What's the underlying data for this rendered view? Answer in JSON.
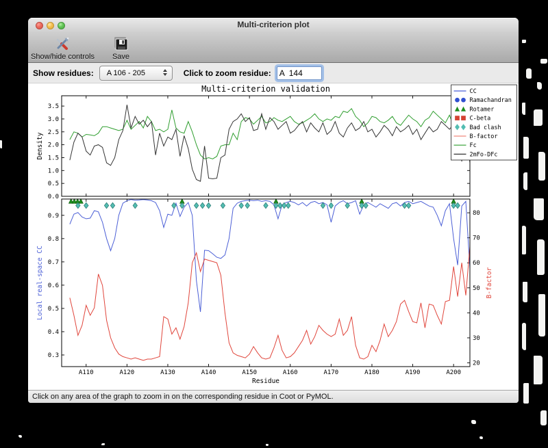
{
  "window": {
    "title": "Multi-criterion plot"
  },
  "toolbar": {
    "buttons": [
      {
        "id": "show-hide-controls",
        "label": "Show/hide controls",
        "icon": "tools-icon"
      },
      {
        "id": "save",
        "label": "Save",
        "icon": "floppy-disk-icon"
      }
    ]
  },
  "controls": {
    "show_residues_label": "Show residues:",
    "residue_range_value": "A 106 - 205",
    "zoom_residue_label": "Click to zoom residue:",
    "zoom_residue_value": "A  144"
  },
  "status_bar": {
    "text": "Click on any area of the graph to zoom in on the corresponding residue in Coot or PyMOL."
  },
  "chart_data": {
    "type": "line",
    "title": "Multi-criterion validation",
    "xlabel": "Residue",
    "x_start": 106,
    "x_range": [
      104,
      204
    ],
    "x_tick_values": [
      110,
      120,
      130,
      140,
      150,
      160,
      170,
      180,
      190,
      200
    ],
    "x_tick_labels": [
      "A110",
      "A120",
      "A130",
      "A140",
      "A150",
      "A160",
      "A170",
      "A180",
      "A190",
      "A200"
    ],
    "grid": false,
    "legend_position": "top-right",
    "legend": [
      {
        "label": "CC",
        "type": "line",
        "color": "#4b5fd6"
      },
      {
        "label": "Ramachandran",
        "type": "circle",
        "color": "#3050d0"
      },
      {
        "label": "Rotamer",
        "type": "triangle",
        "color": "#1e8f1e"
      },
      {
        "label": "C-beta",
        "type": "square",
        "color": "#d44232"
      },
      {
        "label": "Bad clash",
        "type": "diamond",
        "color": "#53bdb2"
      },
      {
        "label": "B-factor",
        "type": "line",
        "color": "#f0867c"
      },
      {
        "label": "Fc",
        "type": "line",
        "color": "#2f9e2f"
      },
      {
        "label": "2mFo-DFc",
        "type": "line",
        "color": "#333333"
      }
    ],
    "panels": [
      {
        "name": "density",
        "ylabel": "Density",
        "ylabel_color": "#000000",
        "ylim": [
          0,
          3.9
        ],
        "yticks": [
          0.0,
          0.5,
          1.0,
          1.5,
          2.0,
          2.5,
          3.0,
          3.5
        ],
        "series": [
          {
            "name": "Fc",
            "color": "#2f9e2f",
            "values": [
              2.2,
              2.5,
              2.45,
              2.3,
              2.4,
              2.38,
              2.35,
              2.45,
              2.7,
              2.7,
              2.65,
              2.6,
              2.55,
              2.6,
              2.95,
              2.6,
              2.75,
              2.9,
              2.65,
              3.1,
              2.9,
              2.55,
              2.6,
              2.5,
              2.6,
              3.35,
              2.65,
              2.5,
              2.45,
              2.9,
              2.5,
              2.0,
              1.6,
              1.45,
              1.5,
              1.45,
              1.55,
              1.95,
              2.0,
              2.0,
              2.45,
              2.2,
              2.9,
              3.05,
              3.0,
              2.8,
              2.95,
              3.1,
              2.85,
              2.9,
              3.05,
              2.95,
              2.9,
              3.0,
              3.1,
              2.9,
              2.8,
              2.85,
              2.95,
              3.05,
              3.2,
              3.0,
              2.9,
              3.0,
              2.95,
              3.1,
              3.05,
              3.3,
              3.25,
              3.4,
              3.1,
              2.95,
              2.7,
              2.85,
              3.1,
              3.05,
              2.9,
              2.85,
              2.95,
              3.1,
              2.85,
              2.75,
              2.95,
              3.15,
              3.0,
              2.9,
              2.7,
              2.95,
              3.05,
              3.3,
              3.15,
              3.0,
              2.85,
              3.15,
              2.7,
              3.25,
              3.0,
              3.2,
              3.15
            ]
          },
          {
            "name": "2mFo-DFc",
            "color": "#333333",
            "values": [
              1.4,
              2.1,
              2.45,
              2.3,
              1.75,
              1.6,
              1.95,
              2.0,
              1.9,
              1.3,
              1.2,
              1.5,
              2.2,
              2.55,
              3.55,
              2.65,
              3.1,
              2.8,
              2.95,
              2.7,
              2.9,
              1.6,
              2.45,
              1.95,
              2.3,
              2.2,
              2.6,
              1.55,
              2.35,
              1.85,
              1.05,
              0.65,
              0.58,
              1.95,
              0.7,
              0.68,
              0.7,
              1.5,
              1.6,
              2.6,
              2.9,
              3.0,
              3.2,
              2.9,
              3.05,
              2.55,
              2.6,
              3.2,
              2.6,
              3.05,
              2.9,
              2.6,
              2.75,
              2.9,
              2.45,
              2.55,
              2.75,
              2.9,
              2.5,
              2.85,
              2.65,
              2.5,
              2.85,
              2.4,
              2.55,
              2.9,
              2.45,
              2.3,
              2.65,
              2.85,
              2.55,
              2.65,
              2.9,
              2.5,
              2.6,
              2.3,
              2.5,
              2.75,
              2.6,
              2.35,
              2.7,
              2.5,
              2.6,
              2.75,
              2.4,
              2.6,
              2.2,
              2.45,
              2.7,
              2.5,
              2.6,
              2.9,
              2.75,
              2.6,
              2.8,
              2.6,
              1.35,
              2.65,
              1.3
            ]
          }
        ]
      },
      {
        "name": "cc-bfactor",
        "left_axis": {
          "label": "Local real-space CC",
          "color": "#4b5fd6",
          "ylim": [
            0.25,
            0.97
          ],
          "yticks": [
            0.3,
            0.4,
            0.5,
            0.6,
            0.7,
            0.8,
            0.9
          ]
        },
        "right_axis": {
          "label": "B-factor",
          "color": "#e0453b",
          "ylim": [
            18.5,
            85.5
          ],
          "yticks": [
            20,
            30,
            40,
            50,
            60,
            70,
            80
          ]
        },
        "series": [
          {
            "name": "CC",
            "axis": "left",
            "color": "#4b5fd6",
            "values": [
              0.862,
              0.905,
              0.912,
              0.893,
              0.885,
              0.888,
              0.92,
              0.915,
              0.87,
              0.8,
              0.748,
              0.8,
              0.9,
              0.952,
              0.963,
              0.968,
              0.965,
              0.966,
              0.968,
              0.966,
              0.963,
              0.955,
              0.92,
              0.848,
              0.905,
              0.9,
              0.952,
              0.895,
              0.935,
              0.955,
              0.9,
              0.62,
              0.485,
              0.75,
              0.748,
              0.735,
              0.72,
              0.715,
              0.73,
              0.8,
              0.93,
              0.952,
              0.96,
              0.963,
              0.965,
              0.963,
              0.965,
              0.96,
              0.963,
              0.96,
              0.945,
              0.885,
              0.945,
              0.955,
              0.96,
              0.955,
              0.945,
              0.955,
              0.94,
              0.955,
              0.96,
              0.95,
              0.955,
              0.945,
              0.87,
              0.94,
              0.955,
              0.963,
              0.95,
              0.955,
              0.963,
              0.905,
              0.945,
              0.955,
              0.945,
              0.935,
              0.95,
              0.94,
              0.93,
              0.95,
              0.955,
              0.94,
              0.955,
              0.96,
              0.95,
              0.955,
              0.96,
              0.95,
              0.94,
              0.935,
              0.9,
              0.855,
              0.92,
              0.95,
              0.8,
              0.686,
              0.94,
              0.96,
              0.67
            ]
          },
          {
            "name": "B-factor",
            "axis": "right",
            "color": "#e0453b",
            "values": [
              46,
              39,
              31,
              35,
              43,
              39,
              42,
              55.5,
              51,
              37,
              30,
              26,
              23.5,
              22.5,
              22,
              21.5,
              22,
              21.5,
              21,
              21.5,
              21.5,
              22,
              22.5,
              38.5,
              37.5,
              31.5,
              34,
              29.5,
              34.5,
              44,
              60,
              64,
              56.5,
              61.5,
              61,
              60.5,
              60,
              55,
              40,
              28,
              24,
              23,
              22.5,
              22,
              23.5,
              26.5,
              24,
              22,
              21.5,
              22,
              26,
              31,
              25,
              22,
              22.5,
              24,
              26.5,
              29,
              33,
              27.5,
              30.5,
              35,
              33,
              31.5,
              30.5,
              31.5,
              37.5,
              31,
              33,
              38.5,
              27,
              22,
              21.5,
              22.5,
              27,
              24.5,
              29,
              35.5,
              30.5,
              33,
              36.5,
              43.5,
              45,
              40.5,
              36.5,
              36,
              44,
              34,
              43.5,
              43,
              39,
              35.5,
              44.5,
              45,
              58.5,
              46.5,
              60,
              47,
              66.5
            ]
          }
        ],
        "outlier_markers": [
          {
            "name": "Ramachandran",
            "shape": "circle",
            "fill": "#3050d0",
            "edge": "#1a2f8a",
            "residues": []
          },
          {
            "name": "Rotamer",
            "shape": "triangle",
            "fill": "#1e8f1e",
            "edge": "#0c5c0c",
            "residues": [
              106.3,
              107.1,
              107.9,
              108.7,
              133.5,
              156.5,
              177.5,
              200
            ]
          },
          {
            "name": "C-beta",
            "shape": "square",
            "fill": "#d44232",
            "edge": "#8f2418",
            "residues": []
          },
          {
            "name": "Bad clash",
            "shape": "diamond",
            "fill": "#53bdb2",
            "edge": "#2a7a72",
            "residues": [
              108,
              110,
              115,
              116.5,
              122,
              131.5,
              133.5,
              137,
              138.5,
              140,
              143.5,
              148,
              149.5,
              154,
              156.5,
              157.5,
              158.5,
              159.5,
              168,
              170,
              174,
              177.5,
              178.5,
              188,
              189,
              200,
              201
            ]
          }
        ]
      }
    ]
  }
}
